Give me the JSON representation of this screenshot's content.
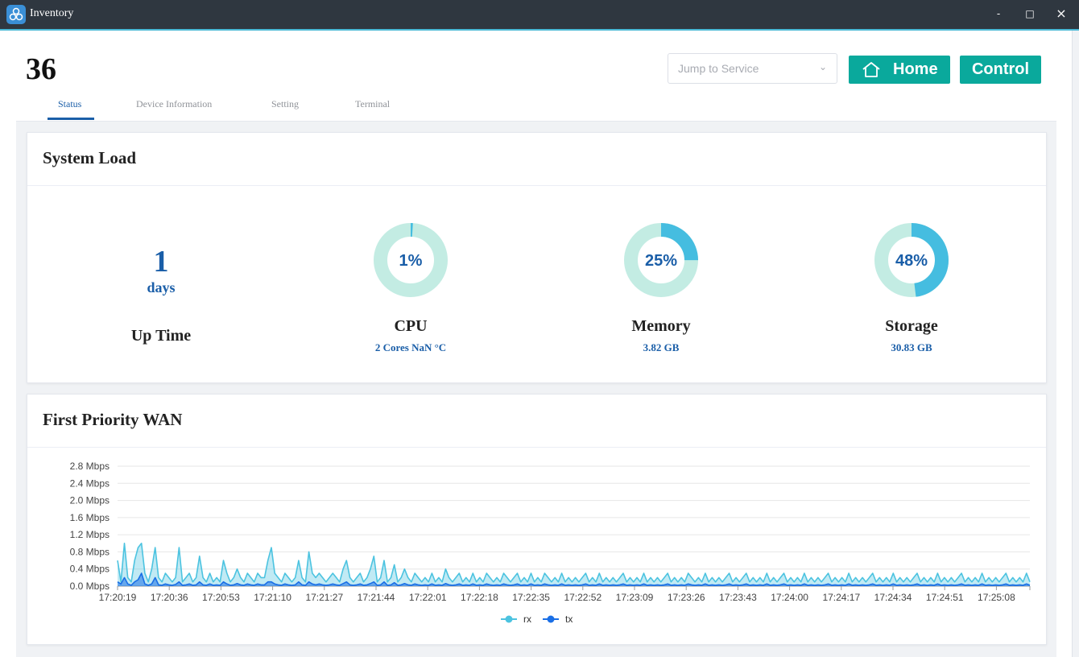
{
  "window": {
    "title": "Inventory",
    "minimize": "-",
    "maximize": "□",
    "close": "×"
  },
  "header": {
    "device_title": "36",
    "jump_placeholder": "Jump to Service",
    "home_label": "Home",
    "control_label": "Control"
  },
  "tabs": [
    {
      "label": "Status",
      "active": true
    },
    {
      "label": "Device Information",
      "active": false
    },
    {
      "label": "Setting",
      "active": false
    },
    {
      "label": "Terminal",
      "active": false
    }
  ],
  "system_load": {
    "title": "System Load",
    "uptime": {
      "value": "1",
      "unit": "days",
      "label": "Up Time"
    },
    "cpu": {
      "percent": 1,
      "text": "1%",
      "label": "CPU",
      "sub": "2 Cores NaN °C"
    },
    "memory": {
      "percent": 25,
      "text": "25%",
      "label": "Memory",
      "sub": "3.82 GB"
    },
    "storage": {
      "percent": 48,
      "text": "48%",
      "label": "Storage",
      "sub": "30.83 GB"
    },
    "colors": {
      "track": "#c3ece3",
      "fill": "#45bde0"
    }
  },
  "wan": {
    "title": "First Priority WAN",
    "chart_data": {
      "type": "area",
      "ylim": [
        0,
        2.8
      ],
      "yticks": [
        "0.0 Mbps",
        "0.4 Mbps",
        "0.8 Mbps",
        "1.2 Mbps",
        "1.6 Mbps",
        "2.0 Mbps",
        "2.4 Mbps",
        "2.8 Mbps"
      ],
      "xticks": [
        "17:20:19",
        "17:20:36",
        "17:20:53",
        "17:21:10",
        "17:21:27",
        "17:21:44",
        "17:22:01",
        "17:22:18",
        "17:22:35",
        "17:22:52",
        "17:23:09",
        "17:23:26",
        "17:23:43",
        "17:24:00",
        "17:24:17",
        "17:24:34",
        "17:24:51",
        "17:25:08"
      ],
      "series": [
        {
          "name": "rx",
          "color": "#4cc3e0",
          "values": [
            0.6,
            0.1,
            1.0,
            0.2,
            0.1,
            0.6,
            0.9,
            1.0,
            0.3,
            0.1,
            0.4,
            0.9,
            0.2,
            0.1,
            0.3,
            0.2,
            0.1,
            0.2,
            0.9,
            0.1,
            0.2,
            0.3,
            0.1,
            0.2,
            0.7,
            0.2,
            0.1,
            0.3,
            0.1,
            0.2,
            0.1,
            0.6,
            0.3,
            0.1,
            0.2,
            0.4,
            0.2,
            0.1,
            0.3,
            0.2,
            0.1,
            0.3,
            0.2,
            0.2,
            0.6,
            0.9,
            0.3,
            0.2,
            0.1,
            0.3,
            0.2,
            0.1,
            0.2,
            0.6,
            0.2,
            0.1,
            0.8,
            0.3,
            0.2,
            0.3,
            0.2,
            0.1,
            0.2,
            0.3,
            0.2,
            0.1,
            0.4,
            0.6,
            0.2,
            0.1,
            0.2,
            0.3,
            0.1,
            0.2,
            0.4,
            0.7,
            0.1,
            0.2,
            0.6,
            0.1,
            0.2,
            0.5,
            0.1,
            0.2,
            0.4,
            0.2,
            0.1,
            0.3,
            0.2,
            0.1,
            0.2,
            0.1,
            0.3,
            0.1,
            0.2,
            0.1,
            0.4,
            0.2,
            0.1,
            0.2,
            0.3,
            0.1,
            0.2,
            0.1,
            0.3,
            0.1,
            0.2,
            0.1,
            0.3,
            0.2,
            0.1,
            0.2,
            0.1,
            0.3,
            0.2,
            0.1,
            0.2,
            0.3,
            0.1,
            0.2,
            0.1,
            0.3,
            0.1,
            0.2,
            0.1,
            0.3,
            0.2,
            0.1,
            0.2,
            0.1,
            0.3,
            0.1,
            0.2,
            0.1,
            0.2,
            0.1,
            0.2,
            0.3,
            0.1,
            0.2,
            0.1,
            0.3,
            0.1,
            0.2,
            0.1,
            0.2,
            0.1,
            0.2,
            0.3,
            0.1,
            0.2,
            0.1,
            0.2,
            0.1,
            0.3,
            0.1,
            0.2,
            0.1,
            0.2,
            0.1,
            0.2,
            0.3,
            0.1,
            0.2,
            0.1,
            0.2,
            0.1,
            0.3,
            0.2,
            0.1,
            0.2,
            0.1,
            0.3,
            0.1,
            0.2,
            0.1,
            0.2,
            0.1,
            0.2,
            0.3,
            0.1,
            0.2,
            0.1,
            0.2,
            0.3,
            0.1,
            0.2,
            0.1,
            0.2,
            0.1,
            0.3,
            0.1,
            0.2,
            0.1,
            0.2,
            0.3,
            0.1,
            0.2,
            0.1,
            0.2,
            0.1,
            0.3,
            0.1,
            0.2,
            0.1,
            0.2,
            0.1,
            0.2,
            0.3,
            0.1,
            0.2,
            0.1,
            0.2,
            0.1,
            0.3,
            0.1,
            0.2,
            0.1,
            0.2,
            0.1,
            0.2,
            0.3,
            0.1,
            0.2,
            0.1,
            0.2,
            0.1,
            0.3,
            0.1,
            0.2,
            0.1,
            0.2,
            0.1,
            0.2,
            0.3,
            0.1,
            0.2,
            0.1,
            0.2,
            0.1,
            0.3,
            0.1,
            0.2,
            0.1,
            0.2,
            0.1,
            0.2,
            0.3,
            0.1,
            0.2,
            0.1,
            0.2,
            0.1,
            0.3,
            0.1,
            0.2,
            0.1,
            0.2,
            0.1,
            0.2,
            0.3,
            0.1,
            0.2,
            0.1,
            0.2,
            0.1,
            0.3,
            0.1
          ]
        },
        {
          "name": "tx",
          "color": "#1a6fe6",
          "values": [
            0.1,
            0.05,
            0.2,
            0.05,
            0.02,
            0.1,
            0.15,
            0.3,
            0.05,
            0.02,
            0.05,
            0.2,
            0.03,
            0.02,
            0.05,
            0.03,
            0.02,
            0.04,
            0.1,
            0.02,
            0.03,
            0.05,
            0.02,
            0.03,
            0.1,
            0.03,
            0.02,
            0.05,
            0.02,
            0.03,
            0.02,
            0.1,
            0.05,
            0.02,
            0.03,
            0.06,
            0.03,
            0.02,
            0.05,
            0.03,
            0.02,
            0.05,
            0.03,
            0.03,
            0.1,
            0.1,
            0.05,
            0.03,
            0.02,
            0.05,
            0.03,
            0.02,
            0.03,
            0.1,
            0.03,
            0.02,
            0.1,
            0.05,
            0.03,
            0.05,
            0.03,
            0.02,
            0.03,
            0.05,
            0.03,
            0.02,
            0.06,
            0.1,
            0.03,
            0.02,
            0.03,
            0.05,
            0.02,
            0.03,
            0.06,
            0.1,
            0.02,
            0.03,
            0.1,
            0.02,
            0.03,
            0.08,
            0.02,
            0.03,
            0.06,
            0.03,
            0.02,
            0.05,
            0.03,
            0.02,
            0.03,
            0.02,
            0.05,
            0.02,
            0.03,
            0.02,
            0.06,
            0.03,
            0.02,
            0.03,
            0.05,
            0.02,
            0.03,
            0.02,
            0.05,
            0.02,
            0.03,
            0.02,
            0.05,
            0.03,
            0.02,
            0.03,
            0.02,
            0.05,
            0.03,
            0.02,
            0.03,
            0.05,
            0.02,
            0.03,
            0.02,
            0.05,
            0.02,
            0.03,
            0.02,
            0.05,
            0.03,
            0.02,
            0.03,
            0.02,
            0.05,
            0.02,
            0.03,
            0.02,
            0.03,
            0.02,
            0.03,
            0.05,
            0.02,
            0.03,
            0.02,
            0.05,
            0.02,
            0.03,
            0.02,
            0.03,
            0.02,
            0.03,
            0.05,
            0.02,
            0.03,
            0.02,
            0.03,
            0.02,
            0.05,
            0.02,
            0.03,
            0.02,
            0.03,
            0.02,
            0.03,
            0.05,
            0.02,
            0.03,
            0.02,
            0.03,
            0.02,
            0.05,
            0.03,
            0.02,
            0.03,
            0.02,
            0.05,
            0.02,
            0.03,
            0.02,
            0.03,
            0.02,
            0.03,
            0.05,
            0.02,
            0.03,
            0.02,
            0.03,
            0.05,
            0.02,
            0.03,
            0.02,
            0.03,
            0.02,
            0.05,
            0.02,
            0.03,
            0.02,
            0.03,
            0.05,
            0.02,
            0.03,
            0.02,
            0.03,
            0.02,
            0.05,
            0.02,
            0.03,
            0.02,
            0.03,
            0.02,
            0.03,
            0.05,
            0.02,
            0.03,
            0.02,
            0.03,
            0.02,
            0.05,
            0.02,
            0.03,
            0.02,
            0.03,
            0.02,
            0.03,
            0.05,
            0.02,
            0.03,
            0.02,
            0.03,
            0.02,
            0.05,
            0.02,
            0.03,
            0.02,
            0.03,
            0.02,
            0.03,
            0.05,
            0.02,
            0.03,
            0.02,
            0.03,
            0.02,
            0.05,
            0.02,
            0.03,
            0.02,
            0.03,
            0.02,
            0.03,
            0.05,
            0.02,
            0.03,
            0.02,
            0.03,
            0.02,
            0.05,
            0.02,
            0.03,
            0.02,
            0.03,
            0.02,
            0.03,
            0.05,
            0.02,
            0.03,
            0.02,
            0.03,
            0.02,
            0.05,
            0.02
          ]
        }
      ]
    }
  }
}
